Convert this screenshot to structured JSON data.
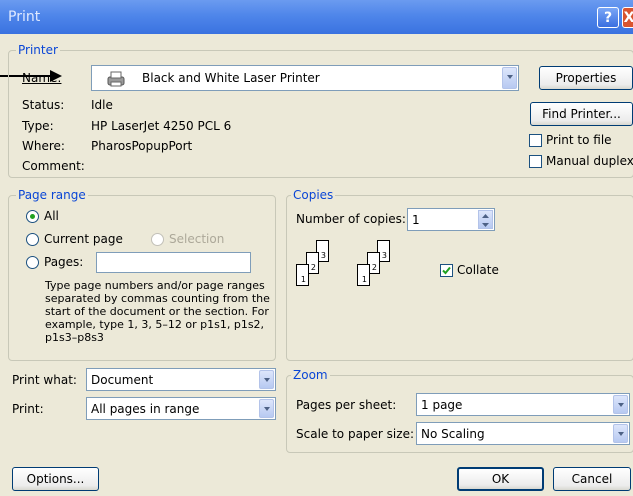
{
  "window": {
    "title": "Print",
    "help_glyph": "?",
    "close_glyph": "X"
  },
  "printer": {
    "legend": "Printer",
    "name_label": "Name:",
    "name_value": "Black and White Laser Printer",
    "status_label": "Status:",
    "status_value": "Idle",
    "type_label": "Type:",
    "type_value": "HP LaserJet 4250 PCL 6",
    "where_label": "Where:",
    "where_value": "PharosPopupPort",
    "comment_label": "Comment:",
    "comment_value": "",
    "properties_button": "Properties",
    "find_printer_button": "Find Printer...",
    "print_to_file_label": "Print to file",
    "print_to_file_checked": false,
    "manual_duplex_label": "Manual duplex",
    "manual_duplex_checked": false
  },
  "page_range": {
    "legend": "Page range",
    "all_label": "All",
    "current_page_label": "Current page",
    "selection_label": "Selection",
    "pages_label": "Pages:",
    "pages_value": "",
    "selected": "All",
    "help_text": "Type page numbers and/or page ranges separated by commas counting from the start of the document or the section. For example, type 1, 3, 5–12 or p1s1, p1s2, p1s3–p8s3"
  },
  "copies": {
    "legend": "Copies",
    "number_label": "Number of copies:",
    "number_value": "1",
    "collate_label": "Collate",
    "collate_checked": true,
    "stack_labels": [
      "1",
      "2",
      "3"
    ]
  },
  "print_what": {
    "label": "Print what:",
    "value": "Document"
  },
  "print": {
    "label": "Print:",
    "value": "All pages in range"
  },
  "zoom": {
    "legend": "Zoom",
    "pages_per_sheet_label": "Pages per sheet:",
    "pages_per_sheet_value": "1 page",
    "scale_label": "Scale to paper size:",
    "scale_value": "No Scaling"
  },
  "footer": {
    "options_button": "Options...",
    "ok_button": "OK",
    "cancel_button": "Cancel"
  },
  "colors": {
    "title_bar": "#4f86ea",
    "legend_text": "#0a46d6",
    "dialog_bg": "#ece9d8"
  }
}
